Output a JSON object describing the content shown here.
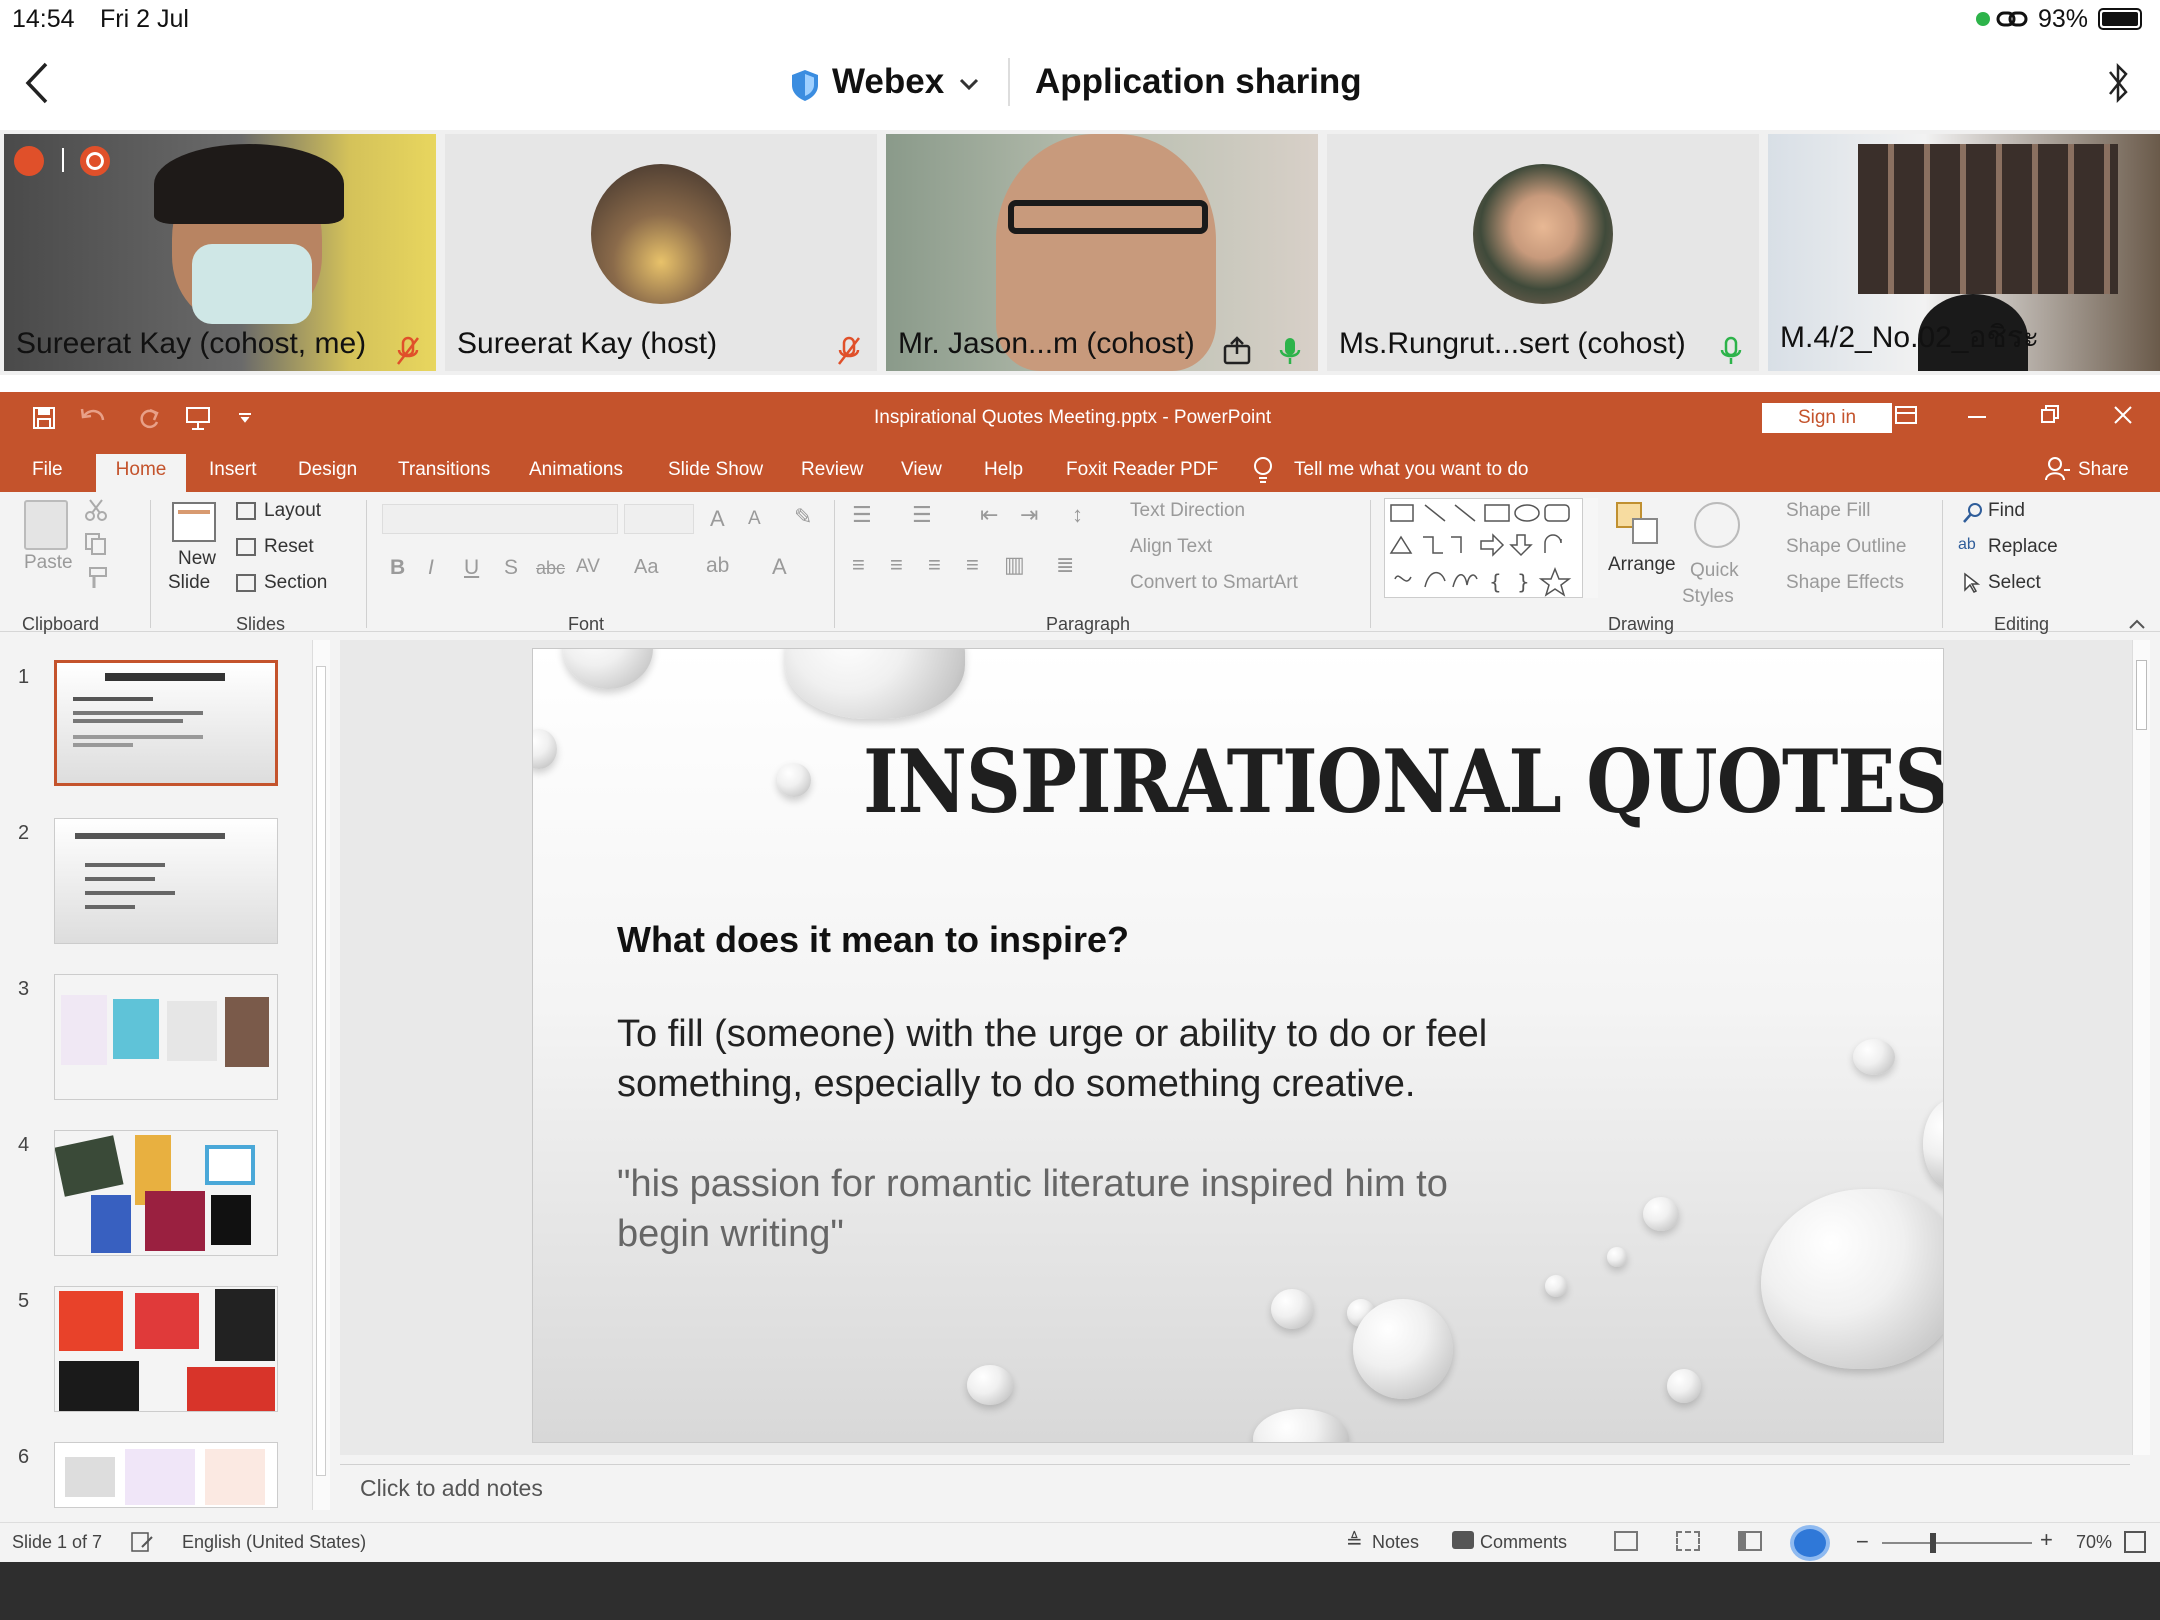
{
  "status": {
    "time": "14:54",
    "date": "Fri 2 Jul",
    "battery": "93%"
  },
  "header": {
    "app_name": "Webex",
    "title": "Application sharing"
  },
  "participants": [
    {
      "name": "Sureerat Kay (cohost, me)"
    },
    {
      "name": "Sureerat Kay (host)"
    },
    {
      "name": "Mr. Jason...m (cohost)"
    },
    {
      "name": "Ms.Rungrut...sert (cohost)"
    },
    {
      "name": "M.4/2_No.02_อชิระ"
    }
  ],
  "ppt": {
    "window_title": "Inspirational Quotes Meeting.pptx  -  PowerPoint",
    "sign_in": "Sign in",
    "tabs": [
      "File",
      "Home",
      "Insert",
      "Design",
      "Transitions",
      "Animations",
      "Slide Show",
      "Review",
      "View",
      "Help",
      "Foxit Reader PDF"
    ],
    "tell_me": "Tell me what you want to do",
    "share": "Share",
    "ribbon": {
      "paste": "Paste",
      "new_slide_1": "New",
      "new_slide_2": "Slide",
      "layout": "Layout",
      "reset": "Reset",
      "section": "Section",
      "text_direction": "Text Direction",
      "align_text": "Align Text",
      "convert_smartart": "Convert to SmartArt",
      "arrange": "Arrange",
      "quick_styles_1": "Quick",
      "quick_styles_2": "Styles",
      "shape_fill": "Shape Fill",
      "shape_outline": "Shape Outline",
      "shape_effects": "Shape Effects",
      "find": "Find",
      "replace": "Replace",
      "select": "Select",
      "groups": {
        "clipboard": "Clipboard",
        "slides": "Slides",
        "font": "Font",
        "paragraph": "Paragraph",
        "drawing": "Drawing",
        "editing": "Editing"
      }
    },
    "slide_numbers": [
      "1",
      "2",
      "3",
      "4",
      "5",
      "6"
    ],
    "slide": {
      "title": "INSPIRATIONAL QUOTES",
      "question": "What does it mean to inspire?",
      "definition": "To fill (someone) with the urge or ability to do or feel something, especially to do something creative.",
      "example": "\"his passion for romantic literature inspired him to begin writing\""
    },
    "notes_placeholder": "Click to add notes",
    "statusbar": {
      "slide_count": "Slide 1 of 7",
      "language": "English (United States)",
      "notes": "Notes",
      "comments": "Comments",
      "zoom": "70%"
    }
  },
  "colors": {
    "ppt_accent": "#c4532c",
    "mic_on": "#2db34a",
    "mic_off": "#e0502a"
  }
}
